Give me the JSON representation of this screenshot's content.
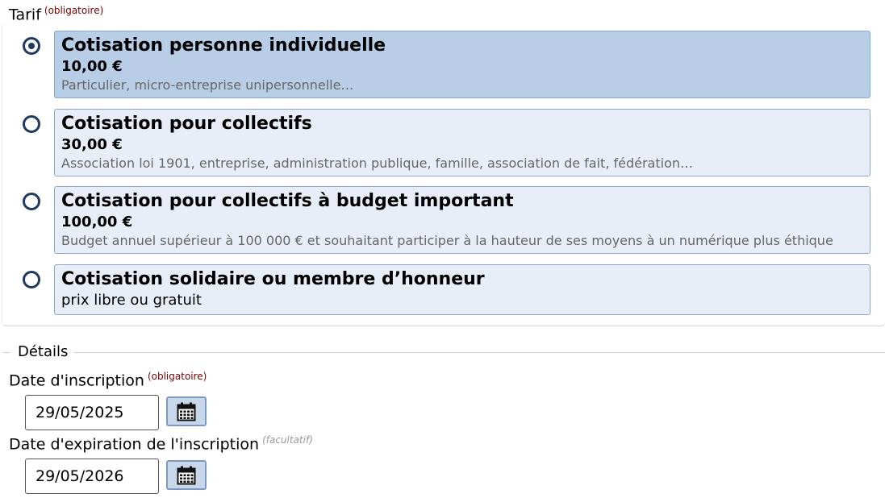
{
  "tarif": {
    "label": "Tarif",
    "required": "(obligatoire)",
    "options": [
      {
        "title": "Cotisation personne individuelle",
        "price": "10,00 €",
        "desc": "Particulier, micro-entreprise unipersonnelle…",
        "selected": true
      },
      {
        "title": "Cotisation pour collectifs",
        "price": "30,00 €",
        "desc": "Association loi 1901, entreprise, administration publique, famille, association de fait, fédération…",
        "selected": false
      },
      {
        "title": "Cotisation pour collectifs à budget important",
        "price": "100,00 €",
        "desc": "Budget annuel supérieur à 100 000 € et souhaitant participer à la hauteur de ses moyens à un numérique plus éthique",
        "selected": false
      },
      {
        "title": "Cotisation solidaire ou membre d’honneur",
        "note": "prix libre ou gratuit",
        "selected": false
      }
    ]
  },
  "details": {
    "legend": "Détails",
    "inscription": {
      "label": "Date d'inscription",
      "required": "(obligatoire)",
      "value": "29/05/2025"
    },
    "expiration": {
      "label": "Date d'expiration de l'inscription",
      "optional": "(facultatif)",
      "value": "29/05/2026"
    },
    "calendar_icon": "calendar-icon"
  }
}
